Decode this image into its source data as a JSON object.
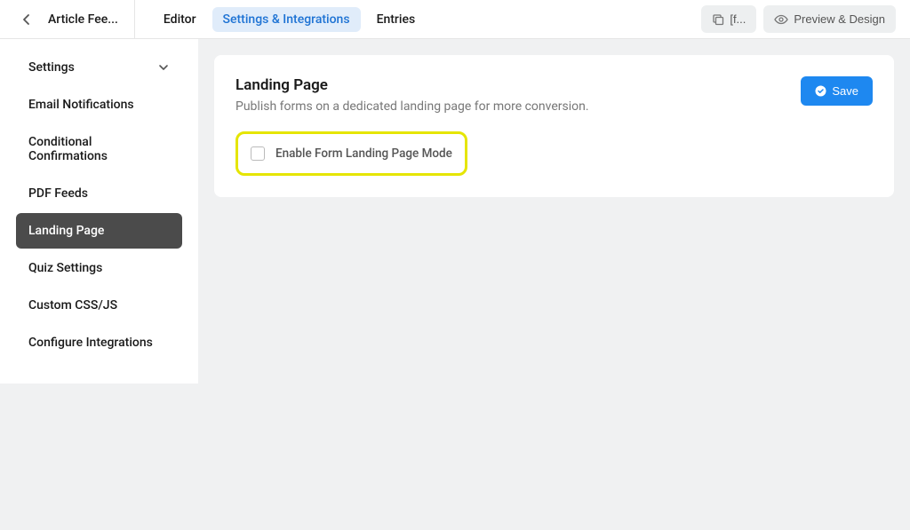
{
  "header": {
    "breadcrumb": "Article Fee...",
    "tabs": [
      {
        "label": "Editor",
        "active": false
      },
      {
        "label": "Settings & Integrations",
        "active": true
      },
      {
        "label": "Entries",
        "active": false
      }
    ],
    "actions": {
      "duplicate": "[f...",
      "preview": "Preview & Design"
    }
  },
  "sidebar": {
    "items": [
      {
        "label": "Settings",
        "hasChevron": true,
        "active": false
      },
      {
        "label": "Email Notifications",
        "hasChevron": false,
        "active": false
      },
      {
        "label": "Conditional Confirmations",
        "hasChevron": false,
        "active": false
      },
      {
        "label": "PDF Feeds",
        "hasChevron": false,
        "active": false
      },
      {
        "label": "Landing Page",
        "hasChevron": false,
        "active": true
      },
      {
        "label": "Quiz Settings",
        "hasChevron": false,
        "active": false
      },
      {
        "label": "Custom CSS/JS",
        "hasChevron": false,
        "active": false
      },
      {
        "label": "Configure Integrations",
        "hasChevron": false,
        "active": false
      }
    ]
  },
  "main": {
    "title": "Landing Page",
    "subtitle": "Publish forms on a dedicated landing page for more conversion.",
    "saveLabel": "Save",
    "checkboxLabel": "Enable Form Landing Page Mode",
    "checkboxChecked": false
  }
}
